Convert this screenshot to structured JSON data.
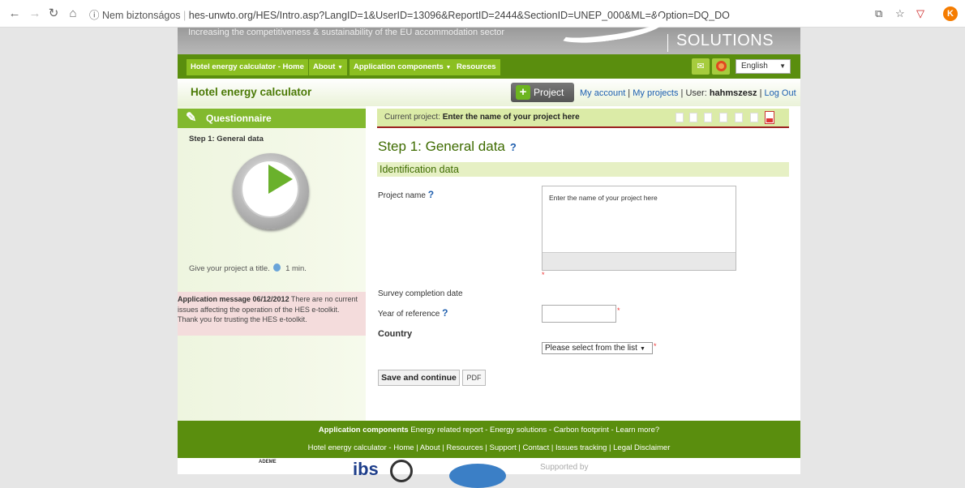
{
  "browser": {
    "security_label": "ⓘ Nem biztonságos",
    "url": "hes-unwto.org/HES/Intro.asp?LangID=1&UserID=13096&ReportID=2444&SectionID=UNEP_000&ML=&Option=DQ_DO",
    "profile_initial": "K"
  },
  "banner": {
    "tagline": "Increasing the competitiveness & sustainability of the EU accommodation sector",
    "brand": "SOLUTIONS"
  },
  "topnav": {
    "items": [
      {
        "label": "Hotel energy calculator - Home"
      },
      {
        "label": "About"
      },
      {
        "label": "Application components"
      },
      {
        "label": "Resources"
      }
    ],
    "language": "English"
  },
  "header": {
    "app_title": "Hotel energy calculator",
    "project_button": "Project",
    "my_account": "My account",
    "my_projects": "My projects",
    "user_prefix": "User:",
    "username": "hahmszesz",
    "logout": "Log Out"
  },
  "sidebar": {
    "questionnaire": "Questionnaire",
    "step_label": "Step 1: General data",
    "tip": "Give your project a title.",
    "tip_time": "1 min.",
    "message_title": "Application message 06/12/2012",
    "message_body": "There are no current issues affecting the operation of the HES e-toolkit.",
    "message_thanks": "Thank you for trusting the HES e-toolkit."
  },
  "main": {
    "current_project_label": "Current project:",
    "current_project_value": "Enter the name of your project here",
    "step_title": "Step 1: General data",
    "section_title": "Identification data",
    "project_name_label": "Project name",
    "project_name_value": "Enter the name of your project here",
    "survey_date_label": "Survey completion date",
    "year_label": "Year of reference",
    "country_label": "Country",
    "country_select": "Please select from the list",
    "save_button": "Save and continue",
    "pdf_button": "PDF",
    "help_glyph": "?"
  },
  "footer": {
    "app_components_label": "Application components",
    "links1": "Energy related report -  Energy solutions -  Carbon footprint -  Learn more?",
    "links2": "Hotel energy calculator - Home  |  About  |  Resources  |  Support  |  Contact  |  Issues tracking  |  Legal Disclaimer",
    "supported_by": "Supported by",
    "logo_ademe": "ADEME",
    "logo_ibs": "ibs"
  },
  "colors": {
    "nav_green": "#5a8e0e",
    "light_green": "#8bbf21",
    "title_green": "#4b7a06",
    "link_blue": "#1c5fb0"
  }
}
